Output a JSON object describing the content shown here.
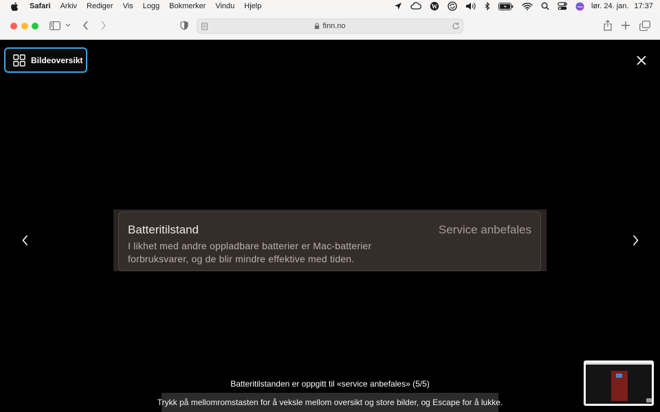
{
  "menubar": {
    "app": "Safari",
    "items": [
      "Arkiv",
      "Rediger",
      "Vis",
      "Logg",
      "Bokmerker",
      "Vindu",
      "Hjelp"
    ],
    "date": "lør. 24. jan.",
    "time": "17:37"
  },
  "browser": {
    "url": "finn.no"
  },
  "viewer": {
    "overview_label": "Bildeoversikt",
    "image": {
      "title": "Batteritilstand",
      "status": "Service anbefales",
      "description": "I likhet med andre oppladbare batterier er Mac-batterier forbruksvarer, og de blir mindre effektive med tiden."
    },
    "caption": "Batteritilstanden er oppgitt til «service anbefales» (5/5)",
    "help": "Trykk på mellomromstasten for å veksle mellom oversikt og store bilder, og Escape for å lukke."
  },
  "colors": {
    "focus_ring": "#3fa6e0",
    "viewer_background": "#000000",
    "card_background": "#352d2a"
  }
}
